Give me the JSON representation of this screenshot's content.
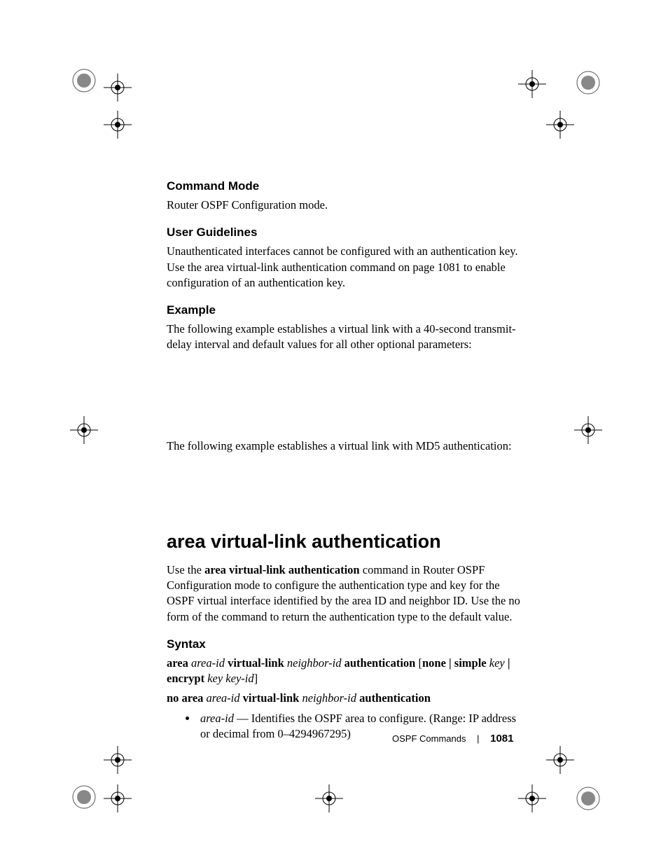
{
  "sections": {
    "commandMode": {
      "heading": "Command Mode",
      "body": "Router OSPF Configuration mode."
    },
    "userGuidelines": {
      "heading": "User Guidelines",
      "body": "Unauthenticated interfaces cannot be configured with an authentication key. Use the area virtual-link authentication command on page 1081 to enable configuration of an authentication key."
    },
    "example": {
      "heading": "Example",
      "body1": "The following example establishes a virtual link with a 40-second transmit-delay interval  and default values for all other optional parameters:",
      "body2": "The following example establishes a virtual link with MD5 authentication:"
    }
  },
  "main": {
    "heading": "area virtual-link authentication",
    "intro_pre": "Use the ",
    "intro_bold": "area virtual-link authentication",
    "intro_post": " command in Router OSPF Configuration mode to configure the authentication type and key for the OSPF virtual interface identified by the area ID and neighbor ID. Use the no form of the command to return the authentication type to the default value."
  },
  "syntax": {
    "heading": "Syntax",
    "line1": {
      "t1": "area ",
      "i1": "area-id",
      "t2": " virtual-link ",
      "i2": "neighbor-id",
      "t3": " authentication ",
      "t4": "[",
      "t5": "none | simple ",
      "i3": "key ",
      "t6": " | encrypt ",
      "i4": "key key-id",
      "t7": "]"
    },
    "line2": {
      "t1": "no area ",
      "i1": "area-id",
      "t2": " virtual-link ",
      "i2": "neighbor-id",
      "t3": " authentication"
    },
    "bullet": {
      "i1": "area-id",
      "rest": " — Identifies the OSPF area to configure. (Range: IP address or decimal from 0–4294967295)"
    }
  },
  "footer": {
    "section": "OSPF Commands",
    "page": "1081"
  }
}
